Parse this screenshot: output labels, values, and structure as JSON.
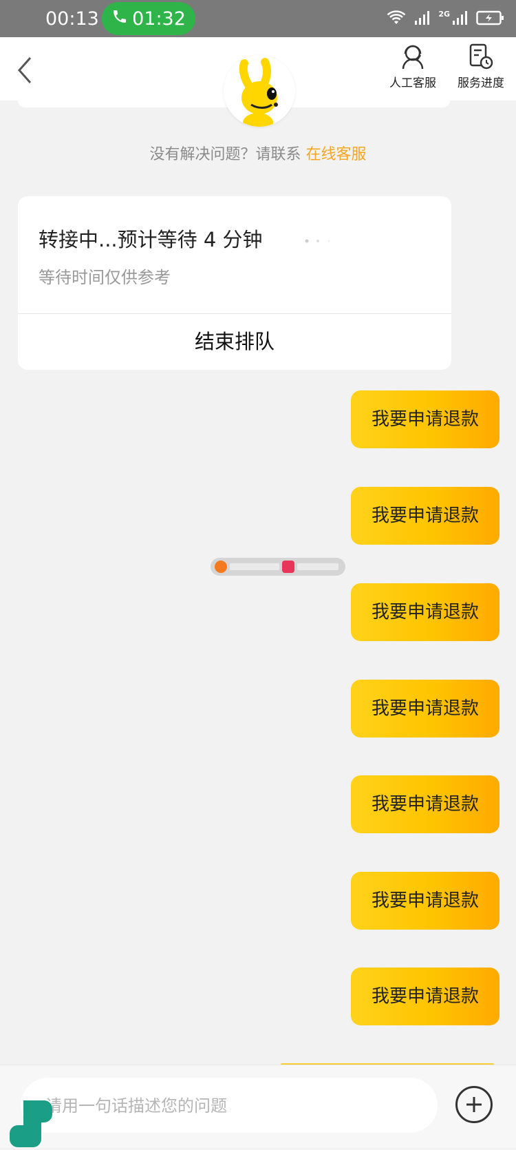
{
  "status_bar": {
    "time": "00:13",
    "call_timer": "01:32",
    "network_label": "2G"
  },
  "header": {
    "human_service": "人工客服",
    "service_progress": "服务进度"
  },
  "hint": {
    "prefix": "没有解决问题？请联系",
    "link": "在线客服"
  },
  "queue_card": {
    "title": "转接中...预计等待 4 分钟",
    "subtitle": "等待时间仅供参考",
    "end_button": "结束排队"
  },
  "messages": [
    {
      "text": "我要申请退款"
    },
    {
      "text": "我要申请退款"
    },
    {
      "text": "我要申请退款"
    },
    {
      "text": "我要申请退款"
    },
    {
      "text": "我要申请退款"
    },
    {
      "text": "我要申请退款"
    },
    {
      "text": "我要申请退款"
    }
  ],
  "input": {
    "placeholder": "请用一句话描述您的问题"
  },
  "colors": {
    "accent": "#ffc400",
    "link": "#f5a623",
    "call_green": "#2fb44a"
  }
}
